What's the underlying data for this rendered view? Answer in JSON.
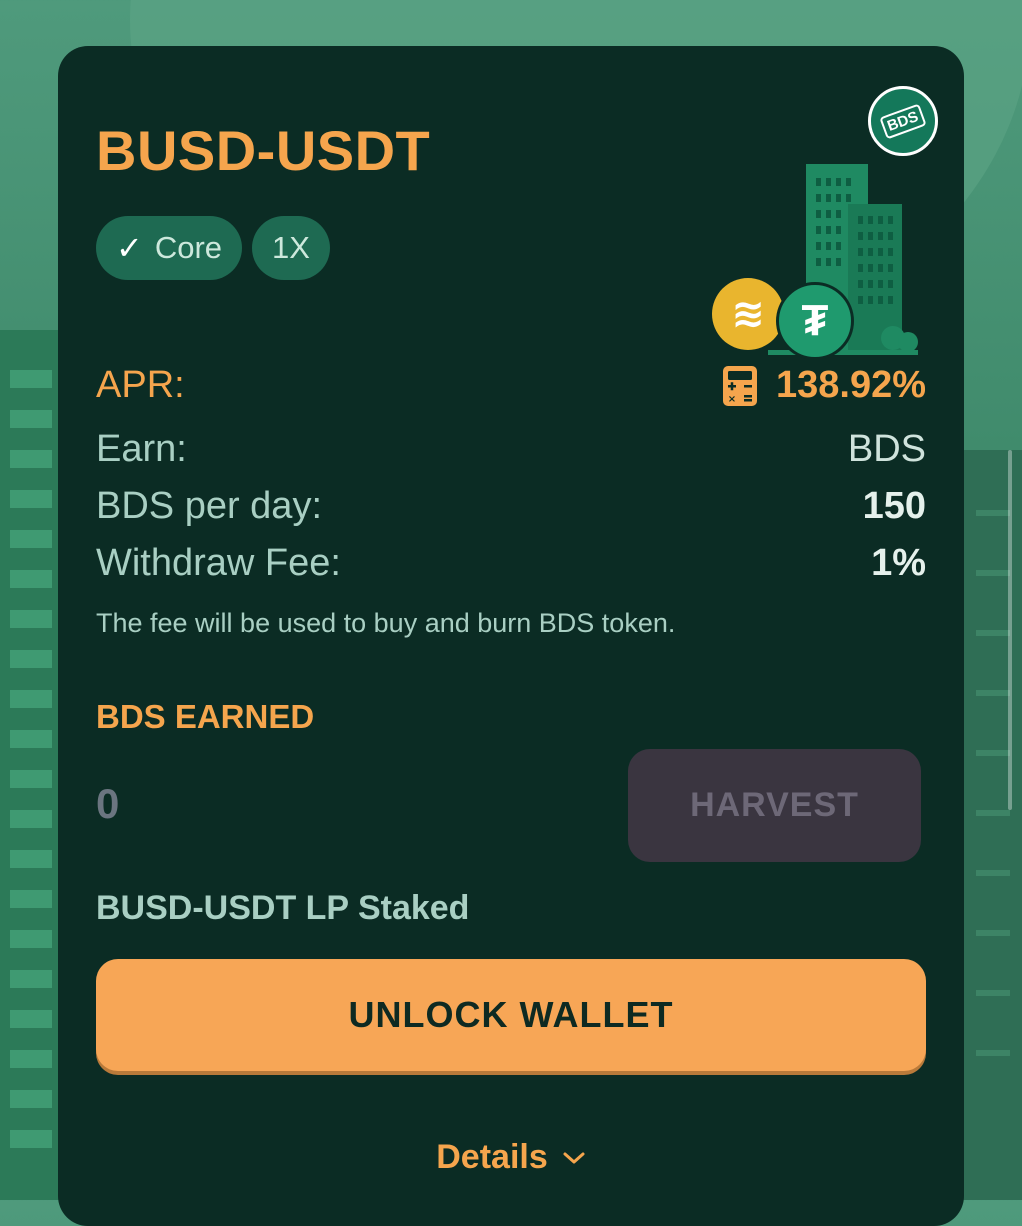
{
  "farm": {
    "title": "BUSD-USDT",
    "badges": {
      "core": "Core",
      "multiplier": "1X"
    },
    "logo_text": "BDS"
  },
  "stats": {
    "apr_label": "APR:",
    "apr_value": "138.92%",
    "earn_label": "Earn:",
    "earn_value": "BDS",
    "per_day_label": "BDS per day:",
    "per_day_value": "150",
    "fee_label": "Withdraw Fee:",
    "fee_value": "1%",
    "fee_note": "The fee will be used to buy and burn BDS token."
  },
  "earned": {
    "title": "BDS EARNED",
    "value": "0",
    "harvest_label": "HARVEST"
  },
  "staked": {
    "label": "BUSD-USDT LP Staked",
    "unlock_label": "UNLOCK WALLET"
  },
  "details": {
    "label": "Details"
  },
  "colors": {
    "accent": "#f5a54d",
    "card_bg": "#0b2c24",
    "badge_bg": "#1e6a52",
    "button_primary": "#f7a656",
    "button_disabled": "#3a3540"
  },
  "icons": [
    "check-icon",
    "bds-logo-icon",
    "busd-coin-icon",
    "usdt-coin-icon",
    "building-illustration",
    "calculator-icon",
    "chevron-down-icon"
  ]
}
